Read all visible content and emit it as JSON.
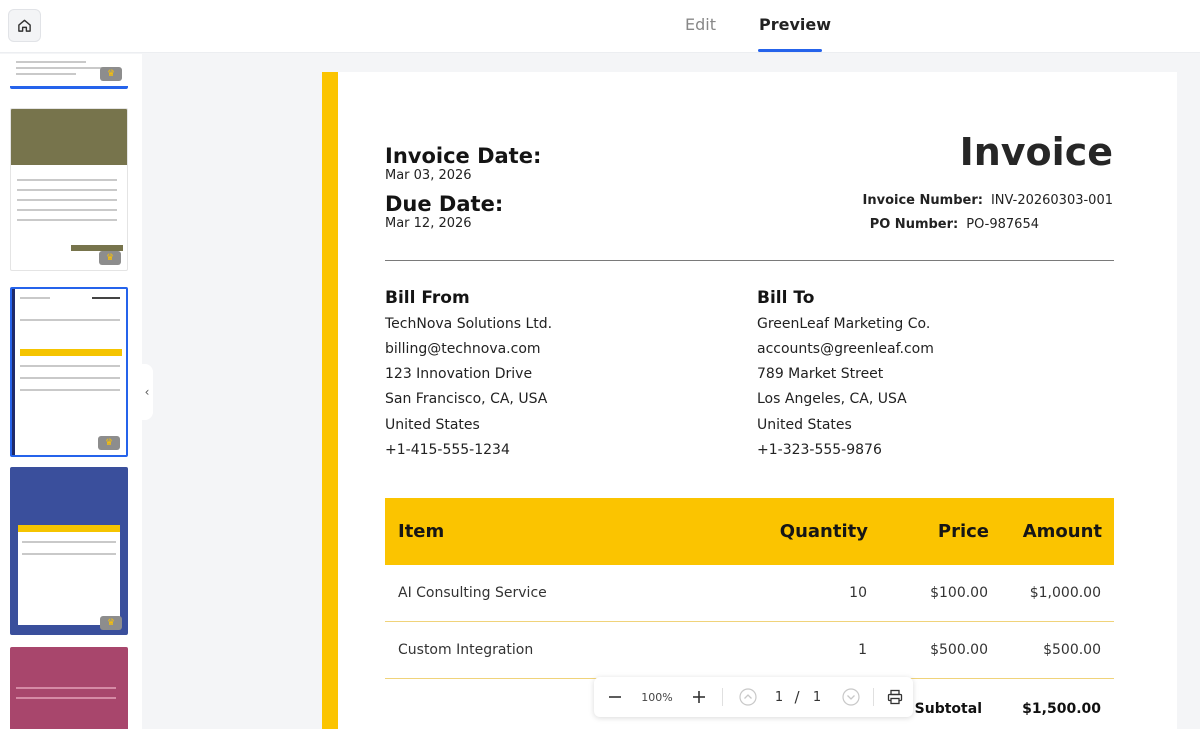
{
  "tabs": {
    "edit": "Edit",
    "preview": "Preview"
  },
  "accent": {
    "tab_underline": "#2563eb",
    "stripe": "#fbc400"
  },
  "invoice": {
    "title": "Invoice",
    "invoice_date_label": "Invoice Date:",
    "invoice_date": "Mar 03, 2026",
    "due_date_label": "Due Date:",
    "due_date": "Mar 12, 2026",
    "invoice_number_label": "Invoice Number:",
    "invoice_number": "INV-20260303-001",
    "po_number_label": "PO Number:",
    "po_number": "PO-987654"
  },
  "bill_from": {
    "title": "Bill From",
    "lines": [
      "TechNova Solutions Ltd.",
      "billing@technova.com",
      "123 Innovation Drive",
      "San Francisco, CA, USA",
      "United States",
      "+1-415-555-1234"
    ]
  },
  "bill_to": {
    "title": "Bill To",
    "lines": [
      "GreenLeaf Marketing Co.",
      "accounts@greenleaf.com",
      "789 Market Street",
      "Los Angeles, CA, USA",
      "United States",
      "+1-323-555-9876"
    ]
  },
  "table": {
    "headers": {
      "item": "Item",
      "quantity": "Quantity",
      "price": "Price",
      "amount": "Amount"
    },
    "rows": [
      {
        "item": "AI Consulting Service",
        "quantity": "10",
        "price": "$100.00",
        "amount": "$1,000.00"
      },
      {
        "item": "Custom Integration",
        "quantity": "1",
        "price": "$500.00",
        "amount": "$500.00"
      }
    ],
    "subtotal_label": "Subtotal",
    "subtotal": "$1,500.00"
  },
  "toolbar": {
    "zoom": "100%",
    "page_current": "1",
    "page_sep": "/",
    "page_total": "1",
    "icons": [
      "zoom-out-icon",
      "zoom-in-icon",
      "page-up-icon",
      "page-down-icon",
      "print-icon"
    ]
  },
  "sidebar": {
    "icons": [
      "home-icon",
      "crown-icon",
      "chevron-left-icon"
    ],
    "thumb_colors": [
      "#ffffff",
      "#77744c",
      "#ffffff",
      "#3a4f9c",
      "#a8466c"
    ]
  }
}
